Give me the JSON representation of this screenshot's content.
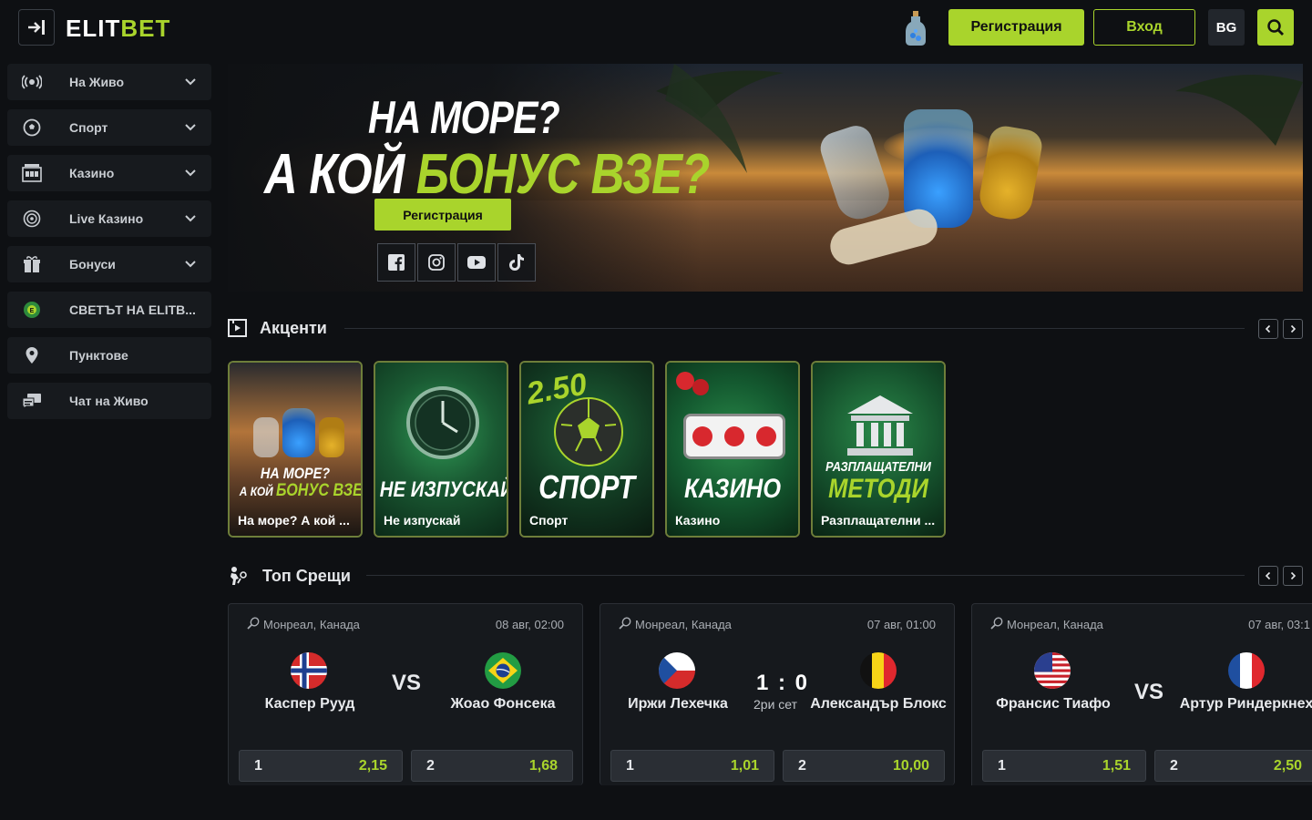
{
  "header": {
    "logo_main": "ELIT",
    "logo_accent": "BET",
    "register_label": "Регистрация",
    "login_label": "Вход",
    "language": "BG"
  },
  "sidebar": {
    "items": [
      {
        "label": "На Живо",
        "icon": "live-broadcast-icon",
        "has_chevron": true
      },
      {
        "label": "Спорт",
        "icon": "soccer-ball-icon",
        "has_chevron": true
      },
      {
        "label": "Казино",
        "icon": "slot-machine-icon",
        "has_chevron": true
      },
      {
        "label": "Live Казино",
        "icon": "roulette-icon",
        "has_chevron": true
      },
      {
        "label": "Бонуси",
        "icon": "gift-icon",
        "has_chevron": true
      },
      {
        "label": "СВЕТЪТ НА ELITB...",
        "icon": "elitbet-world-icon",
        "has_chevron": false
      },
      {
        "label": "Пунктове",
        "icon": "location-pin-icon",
        "has_chevron": false
      },
      {
        "label": "Чат на Живо",
        "icon": "chat-icon",
        "has_chevron": false
      }
    ]
  },
  "banner": {
    "line1": "НА МОРЕ?",
    "line2_white": "А КОЙ ",
    "line2_accent": "БОНУС ВЗЕ?",
    "button_label": "Регистрация",
    "socials": [
      "facebook-icon",
      "instagram-icon",
      "youtube-icon",
      "tiktok-icon"
    ]
  },
  "highlights": {
    "title": "Акценти",
    "tiles": [
      {
        "big_line1": "НА МОРЕ?",
        "big_line2a": "А КОЙ ",
        "big_line2b": "БОНУС ВЗЕ?",
        "caption": "На море? А кой ..."
      },
      {
        "big": "НЕ ИЗПУСКАЙ",
        "caption": "Не изпускай"
      },
      {
        "big": "СПОРТ",
        "odds_text": "2.50",
        "caption": "Спорт"
      },
      {
        "big": "КАЗИНО",
        "caption": "Казино"
      },
      {
        "big_line1": "РАЗПЛАЩАТЕЛНИ",
        "big_line2": "МЕТОДИ",
        "caption": "Разплащателни ..."
      }
    ]
  },
  "top_matches": {
    "title": "Топ Срещи",
    "matches": [
      {
        "location": "Монреал, Канада",
        "date": "08 авг, 02:00",
        "player1": "Каспер Рууд",
        "player2": "Жоао Фонсека",
        "middle": "VS",
        "odd1_key": "1",
        "odd1": "2,15",
        "odd2_key": "2",
        "odd2": "1,68"
      },
      {
        "location": "Монреал, Канада",
        "date": "07 авг, 01:00",
        "player1": "Иржи Лехечка",
        "player2": "Александър Блокс",
        "score": "1 : 0",
        "set": "2ри сет",
        "odd1_key": "1",
        "odd1": "1,01",
        "odd2_key": "2",
        "odd2": "10,00"
      },
      {
        "location": "Монреал, Канада",
        "date": "07 авг, 03:1",
        "player1": "Франсис Тиафо",
        "player2": "Артур Риндеркнех",
        "middle": "VS",
        "odd1_key": "1",
        "odd1": "1,51",
        "odd2_key": "2",
        "odd2": "2,50"
      }
    ]
  },
  "colors": {
    "accent": "#a9d42c",
    "background": "#0e1013",
    "panel": "#171a1e"
  }
}
